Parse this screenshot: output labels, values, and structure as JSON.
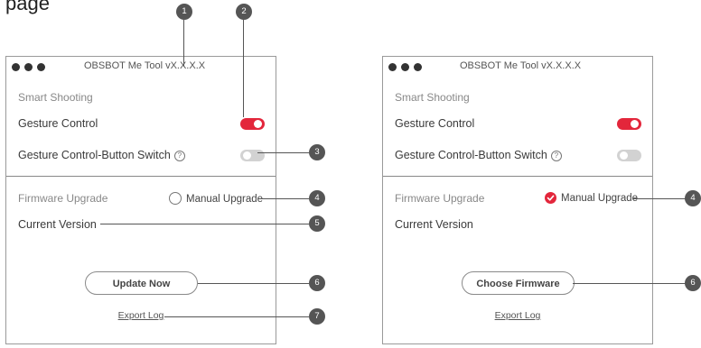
{
  "app": {
    "title": "OBSBOT Me Tool vX.X.X.X"
  },
  "top_fragment": "page",
  "settings": {
    "smart_shooting": "Smart Shooting",
    "gesture_control": "Gesture Control",
    "gesture_switch": "Gesture Control-Button Switch",
    "help_glyph": "?",
    "gesture_control_on": true,
    "gesture_switch_on": false
  },
  "firmware": {
    "title": "Firmware Upgrade",
    "manual_upgrade": "Manual Upgrade",
    "current_version": "Current Version"
  },
  "actions": {
    "update_now": "Update Now",
    "choose_firmware": "Choose Firmware",
    "export_log": "Export Log"
  },
  "left_panel": {
    "manual_upgrade_checked": false
  },
  "right_panel": {
    "manual_upgrade_checked": true
  },
  "callouts": [
    "1",
    "2",
    "3",
    "4",
    "5",
    "6",
    "7",
    "4",
    "6"
  ],
  "colors": {
    "accent": "#e3263b",
    "callout": "#555555",
    "toggle_off": "#d2d2d2"
  }
}
